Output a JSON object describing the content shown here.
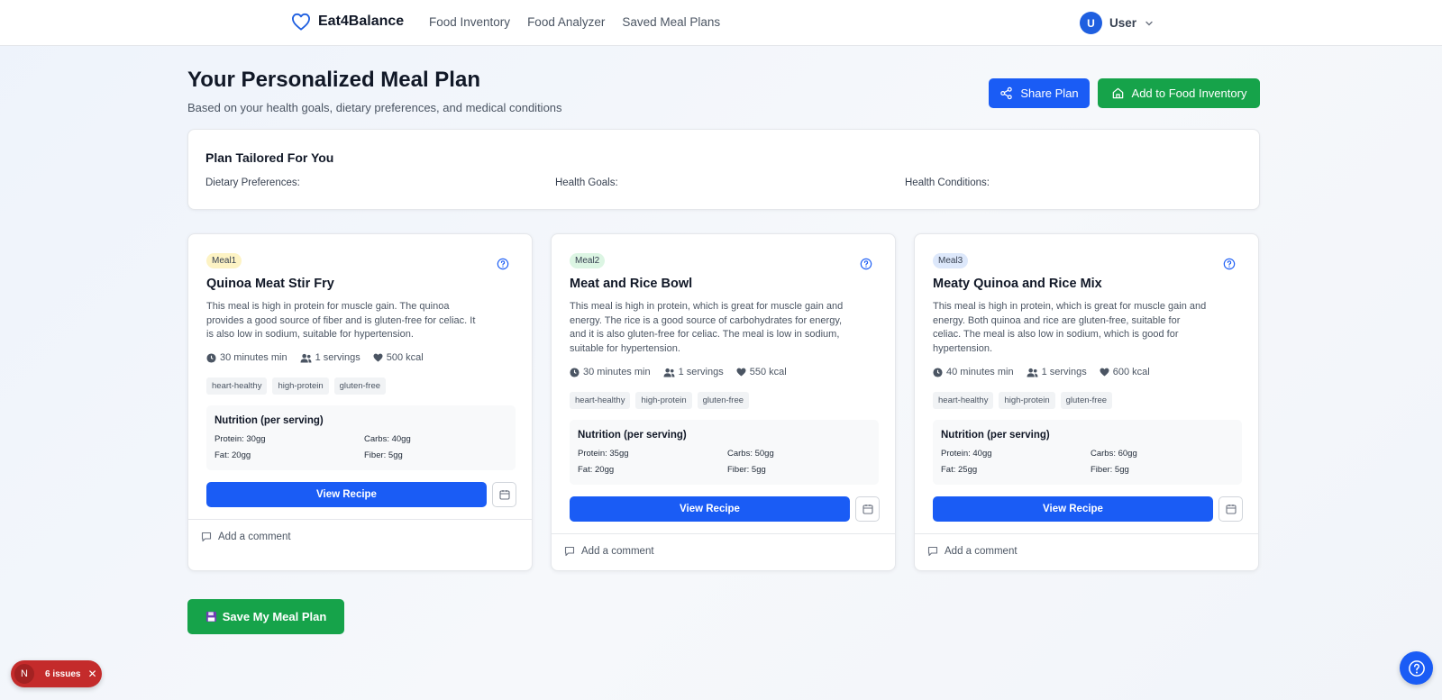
{
  "app": {
    "name": "Eat4Balance"
  },
  "nav": {
    "links": [
      "Food Inventory",
      "Food Analyzer",
      "Saved Meal Plans"
    ]
  },
  "user": {
    "initial": "U",
    "name": "User"
  },
  "header": {
    "title": "Your Personalized Meal Plan",
    "subtitle": "Based on your health goals, dietary preferences, and medical conditions",
    "share_label": "Share Plan",
    "add_label": "Add to Food Inventory"
  },
  "tailored": {
    "title": "Plan Tailored For You",
    "dietary_label": "Dietary Preferences:",
    "goals_label": "Health Goals:",
    "conditions_label": "Health Conditions:"
  },
  "meals": [
    {
      "badge": "Meal1",
      "title": "Quinoa Meat Stir Fry",
      "description": "This meal is high in protein for muscle gain. The quinoa provides a good source of fiber and is gluten-free for celiac. It is also low in sodium, suitable for hypertension.",
      "time": "30 minutes min",
      "servings": "1 servings",
      "calories": "500 kcal",
      "tags": [
        "heart-healthy",
        "high-protein",
        "gluten-free"
      ],
      "nutrition_title": "Nutrition (per serving)",
      "protein": "Protein: 30gg",
      "carbs": "Carbs: 40gg",
      "fat": "Fat: 20gg",
      "fiber": "Fiber: 5gg",
      "view_label": "View Recipe",
      "comment_label": "Add a comment"
    },
    {
      "badge": "Meal2",
      "title": "Meat and Rice Bowl",
      "description": "This meal is high in protein, which is great for muscle gain and energy. The rice is a good source of carbohydrates for energy, and it is also gluten-free for celiac. The meal is low in sodium, suitable for hypertension.",
      "time": "30 minutes min",
      "servings": "1 servings",
      "calories": "550 kcal",
      "tags": [
        "heart-healthy",
        "high-protein",
        "gluten-free"
      ],
      "nutrition_title": "Nutrition (per serving)",
      "protein": "Protein: 35gg",
      "carbs": "Carbs: 50gg",
      "fat": "Fat: 20gg",
      "fiber": "Fiber: 5gg",
      "view_label": "View Recipe",
      "comment_label": "Add a comment"
    },
    {
      "badge": "Meal3",
      "title": "Meaty Quinoa and Rice Mix",
      "description": "This meal is high in protein, which is great for muscle gain and energy. Both quinoa and rice are gluten-free, suitable for celiac. The meal is also low in sodium, which is good for hypertension.",
      "time": "40 minutes min",
      "servings": "1 servings",
      "calories": "600 kcal",
      "tags": [
        "heart-healthy",
        "high-protein",
        "gluten-free"
      ],
      "nutrition_title": "Nutrition (per serving)",
      "protein": "Protein: 40gg",
      "carbs": "Carbs: 60gg",
      "fat": "Fat: 25gg",
      "fiber": "Fiber: 5gg",
      "view_label": "View Recipe",
      "comment_label": "Add a comment"
    }
  ],
  "save_label": "Save My Meal Plan",
  "issues": {
    "initial": "N",
    "label": "6 issues"
  },
  "colors": {
    "primary": "#1a5cf5",
    "success": "#16a34a",
    "danger": "#c42b2b",
    "meal1_badge": "#fdf3c4",
    "meal2_badge": "#dcf5e3",
    "meal3_badge": "#dde8fb"
  },
  "icons": [
    "heart-icon",
    "chevron-down-icon",
    "share-icon",
    "home-icon",
    "help-circle-icon",
    "clock-icon",
    "users-icon",
    "calendar-icon",
    "comment-icon",
    "floppy-disk-icon",
    "close-icon"
  ]
}
